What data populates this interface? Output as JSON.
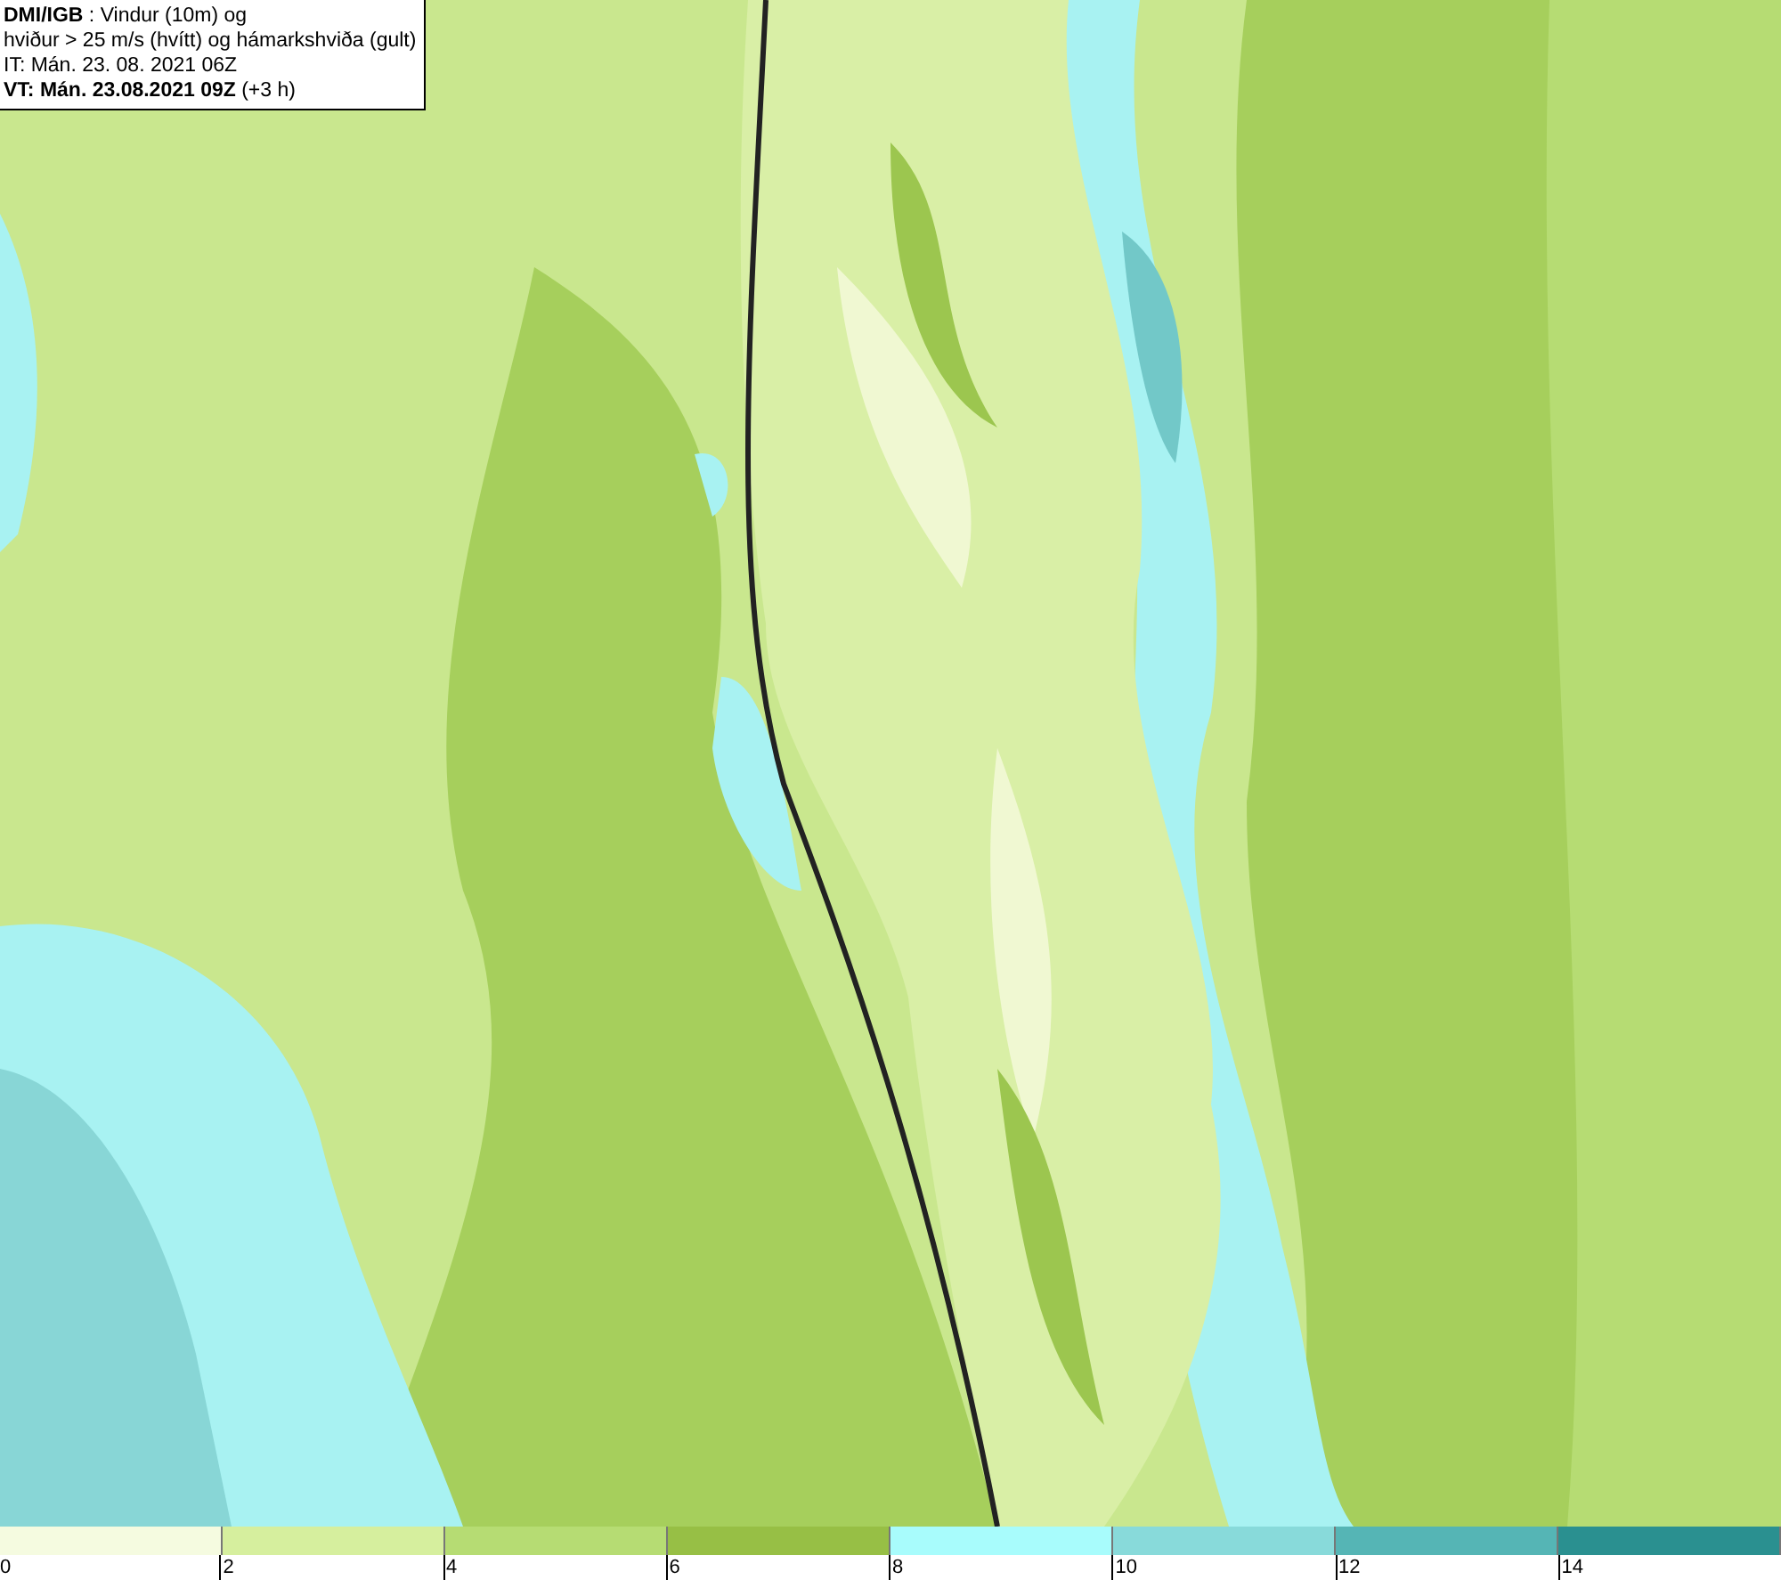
{
  "header": {
    "lines": [
      "**DMI/IGB** : Vindur (10m) og",
      "hviður > 25 m/s (hvítt) og hámarkshviða (gult)",
      "IT: Mán. 23. 08. 2021 06Z",
      "**VT: Mán. 23.08.2021 09Z** (+3 h)"
    ]
  },
  "legend": {
    "bins": [
      {
        "color": "#f5fbe0"
      },
      {
        "color": "#d6ef9e"
      },
      {
        "color": "#b6dc73"
      },
      {
        "color": "#97bf45"
      },
      {
        "color": "#a8fcfc"
      },
      {
        "color": "#88dada"
      },
      {
        "color": "#55b5b5"
      },
      {
        "color": "#2a9090"
      }
    ],
    "ticks": [
      "0",
      "2",
      "4",
      "6",
      "8",
      "10",
      "12",
      "14"
    ]
  }
}
